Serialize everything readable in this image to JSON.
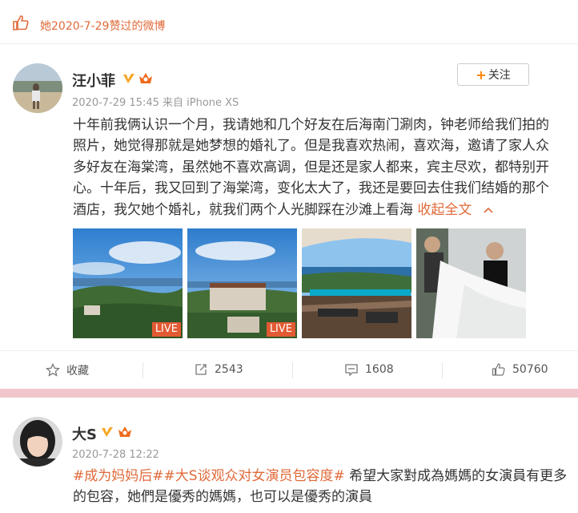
{
  "like_header": {
    "text": "她2020-7-29赞过的微博"
  },
  "post1": {
    "author": "汪小菲",
    "meta": "2020-7-29 15:45 来自 iPhone XS",
    "follow_label": "关注",
    "lines": [
      "十年前我俩认识一个月，我请她和几个好友在后海南门涮肉，钟老师给我们拍的",
      "照片，她觉得那就是她梦想的婚礼了。但是我喜欢热闹，喜欢海，邀请了家人众",
      "多好友在海棠湾，虽然她不喜欢高调，但是还是家人都来，宾主尽欢，都特别开",
      "心。十年后，我又回到了海棠湾，变化太大了，我还是要回去住我们结婚的那个",
      "酒店，我欠她个婚礼，就我们两个人光脚踩在沙滩上看海"
    ],
    "collapse_label": "收起全文",
    "live_label": "LIVE",
    "actions": {
      "favorite": "收藏",
      "repost": "2543",
      "comment": "1608",
      "like": "50760"
    }
  },
  "post2": {
    "author": "大S",
    "meta": "2020-7-28 12:22",
    "tag1": "#成为妈妈后#",
    "tag2": "#大S谈观众对女演员包容度#",
    "line1_rest": " 希望大家對成為媽媽的女演員有更多",
    "line2": "的包容，她們是優秀的媽媽，也可以是優秀的演員"
  },
  "colors": {
    "accent": "#e06a3a",
    "follow_plus": "#ff8200",
    "live_badge": "#e25a33",
    "background": "#f0c6cc"
  }
}
